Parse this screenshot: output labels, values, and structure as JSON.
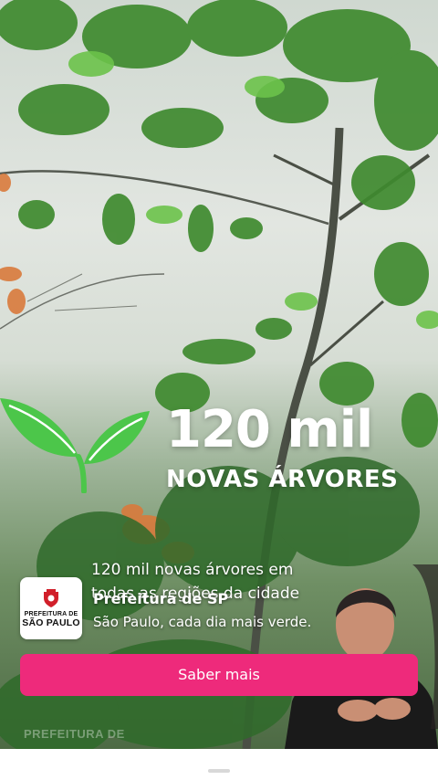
{
  "video": {
    "headline_number": "120 mil",
    "headline_text": "NOVAS ÁRVORES",
    "caption_line1": "120 mil novas árvores em",
    "caption_line2": "todas as regiões da cidade",
    "watermark": "PREFEITURA DE"
  },
  "ad": {
    "logo": {
      "line1": "PREFEITURA DE",
      "line2": "SÃO PAULO"
    },
    "advertiser": "Prefeitura de SP",
    "text": "São Paulo, cada dia mais verde.",
    "cta_label": "Saber mais",
    "cta_color": "#ee2a7b"
  },
  "colors": {
    "sprout": "#4cc64a",
    "logo_seal": "#d11f2a"
  },
  "icons": {
    "sprout": "sprout-icon",
    "seal": "city-seal-icon"
  }
}
